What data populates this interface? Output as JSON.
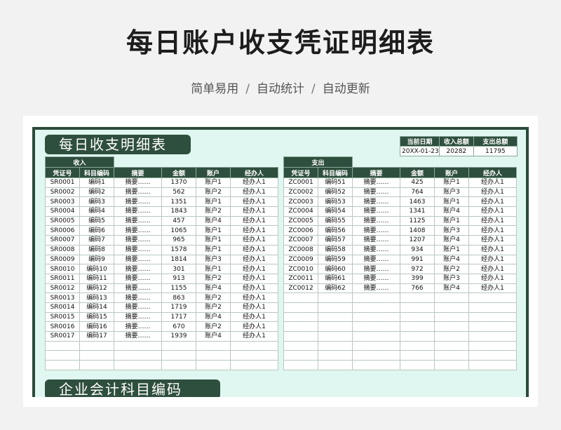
{
  "page": {
    "title": "每日账户收支凭证明细表",
    "subtitle_parts": [
      "简单易用",
      "自动统计",
      "自动更新"
    ],
    "subtitle_sep": "/"
  },
  "sheet": {
    "banner_top": "每日收支明细表",
    "banner_bottom": "企业会计科目编码",
    "stats": {
      "headers": [
        "当前日期",
        "收入总额",
        "支出总额"
      ],
      "values": [
        "20XX-01-23 00:00",
        "20282",
        "11795"
      ]
    },
    "income": {
      "label": "收入",
      "headers": [
        "凭证号",
        "科目编码",
        "摘要",
        "金额",
        "账户",
        "经办人"
      ],
      "rows": [
        [
          "SR0001",
          "编码1",
          "摘要……",
          "1370",
          "账户1",
          "经办人1"
        ],
        [
          "SR0002",
          "编码2",
          "摘要……",
          "562",
          "账户2",
          "经办人1"
        ],
        [
          "SR0003",
          "编码3",
          "摘要……",
          "1351",
          "账户1",
          "经办人1"
        ],
        [
          "SR0004",
          "编码4",
          "摘要……",
          "1843",
          "账户2",
          "经办人1"
        ],
        [
          "SR0005",
          "编码5",
          "摘要……",
          "457",
          "账户4",
          "经办人1"
        ],
        [
          "SR0006",
          "编码6",
          "摘要……",
          "1065",
          "账户1",
          "经办人1"
        ],
        [
          "SR0007",
          "编码7",
          "摘要……",
          "965",
          "账户1",
          "经办人1"
        ],
        [
          "SR0008",
          "编码8",
          "摘要……",
          "1578",
          "账户1",
          "经办人1"
        ],
        [
          "SR0009",
          "编码9",
          "摘要……",
          "1814",
          "账户3",
          "经办人1"
        ],
        [
          "SR0010",
          "编码10",
          "摘要……",
          "301",
          "账户1",
          "经办人1"
        ],
        [
          "SR0011",
          "编码11",
          "摘要……",
          "913",
          "账户2",
          "经办人1"
        ],
        [
          "SR0012",
          "编码12",
          "摘要……",
          "1155",
          "账户4",
          "经办人1"
        ],
        [
          "SR0013",
          "编码13",
          "摘要……",
          "863",
          "账户2",
          "经办人1"
        ],
        [
          "SR0014",
          "编码14",
          "摘要……",
          "1719",
          "账户2",
          "经办人1"
        ],
        [
          "SR0015",
          "编码15",
          "摘要……",
          "1717",
          "账户4",
          "经办人1"
        ],
        [
          "SR0016",
          "编码16",
          "摘要……",
          "670",
          "账户2",
          "经办人1"
        ],
        [
          "SR0017",
          "编码17",
          "摘要……",
          "1939",
          "账户4",
          "经办人1"
        ]
      ]
    },
    "expense": {
      "label": "支出",
      "headers": [
        "凭证号",
        "科目编码",
        "摘要",
        "金额",
        "账户",
        "经办人"
      ],
      "rows": [
        [
          "ZC0001",
          "编码51",
          "摘要……",
          "425",
          "账户1",
          "经办人1"
        ],
        [
          "ZC0002",
          "编码52",
          "摘要……",
          "764",
          "账户3",
          "经办人1"
        ],
        [
          "ZC0003",
          "编码53",
          "摘要……",
          "1463",
          "账户1",
          "经办人1"
        ],
        [
          "ZC0004",
          "编码54",
          "摘要……",
          "1341",
          "账户4",
          "经办人1"
        ],
        [
          "ZC0005",
          "编码55",
          "摘要……",
          "1125",
          "账户1",
          "经办人1"
        ],
        [
          "ZC0006",
          "编码56",
          "摘要……",
          "1408",
          "账户3",
          "经办人1"
        ],
        [
          "ZC0007",
          "编码57",
          "摘要……",
          "1207",
          "账户4",
          "经办人1"
        ],
        [
          "ZC0008",
          "编码58",
          "摘要……",
          "934",
          "账户1",
          "经办人1"
        ],
        [
          "ZC0009",
          "编码59",
          "摘要……",
          "991",
          "账户4",
          "经办人1"
        ],
        [
          "ZC0010",
          "编码60",
          "摘要……",
          "972",
          "账户2",
          "经办人1"
        ],
        [
          "ZC0011",
          "编码61",
          "摘要……",
          "399",
          "账户3",
          "经办人1"
        ],
        [
          "ZC0012",
          "编码62",
          "摘要……",
          "766",
          "账户4",
          "经办人1"
        ]
      ]
    },
    "colors": {
      "header_bg": "#2f4f3e",
      "sheet_bg": "#dff7f0"
    }
  }
}
